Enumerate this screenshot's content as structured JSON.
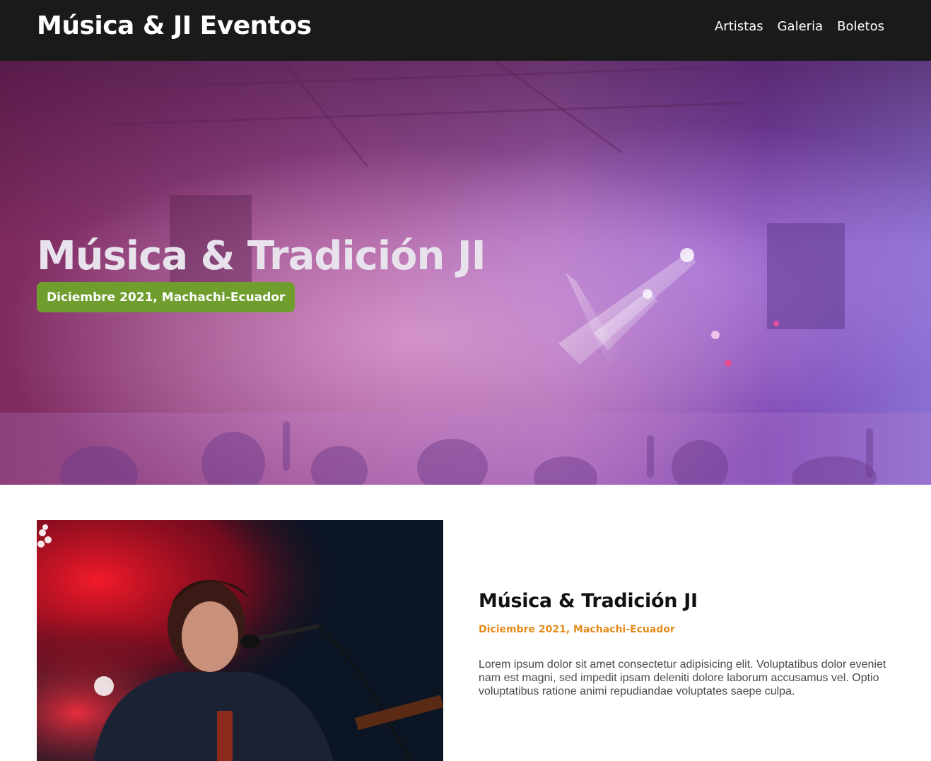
{
  "header": {
    "brand": "Música & JI Eventos",
    "nav": [
      {
        "label": "Artistas"
      },
      {
        "label": "Galeria"
      },
      {
        "label": "Boletos"
      }
    ]
  },
  "hero": {
    "title": "Música & Tradición JI",
    "badge": "Diciembre 2021, Machachi-Ecuador"
  },
  "event": {
    "title": "Música & Tradición JI",
    "date": "Diciembre 2021, Machachi-Ecuador",
    "description": "Lorem ipsum dolor sit amet consectetur adipisicing elit. Voluptatibus dolor eveniet nam est magni, sed impedit ipsam deleniti dolore laborum accusamus vel. Optio voluptatibus ratione animi repudiandae voluptates saepe culpa."
  },
  "colors": {
    "header_bg": "#1a1a1a",
    "badge_bg": "#6f9e2e",
    "date_accent": "#e38b1b"
  }
}
